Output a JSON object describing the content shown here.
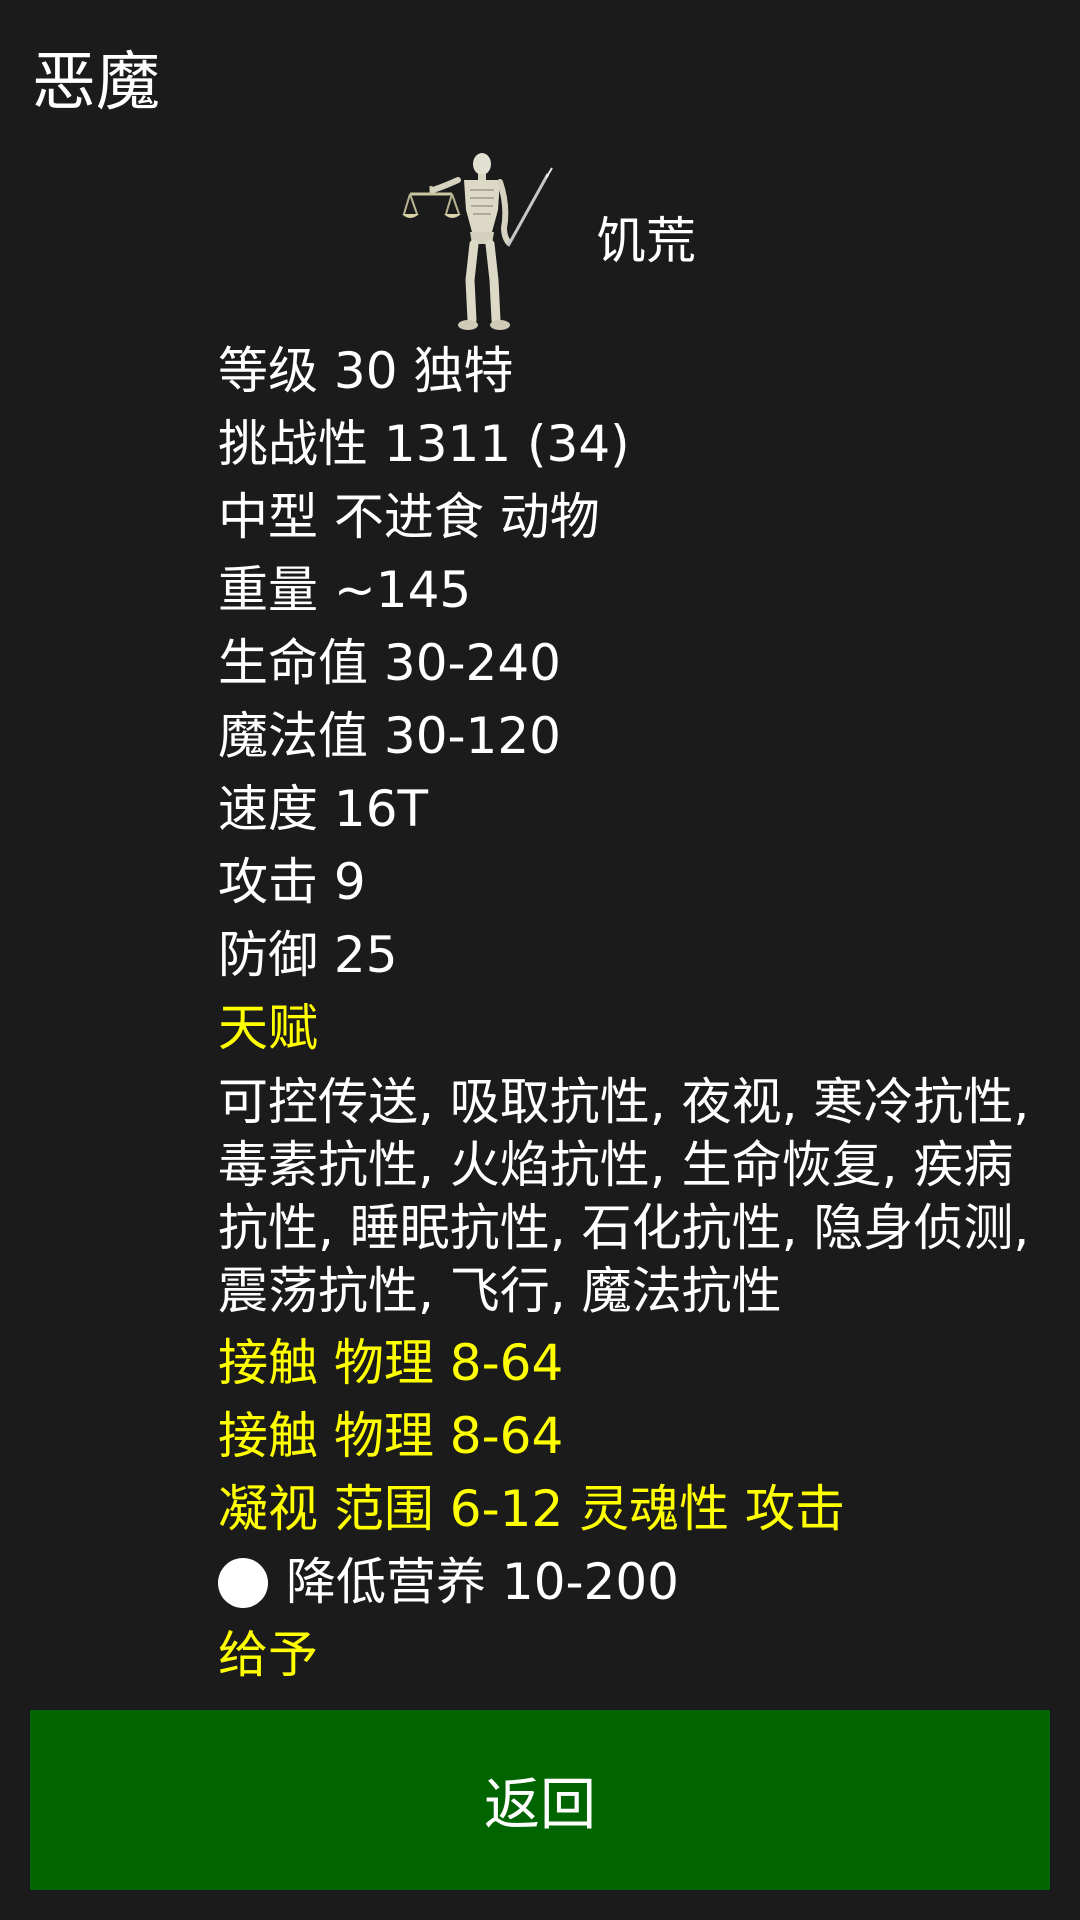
{
  "page": {
    "title": "恶魔"
  },
  "monster": {
    "name": "饥荒",
    "figure_icon": "skeleton-with-scales-and-scythe"
  },
  "stats": {
    "level": "等级 30 独特",
    "challenge": "挑战性 1311 (34)",
    "type": "中型 不进食 动物",
    "weight": "重量 ~145",
    "hp": "生命值 30-240",
    "mp": "魔法值 30-120",
    "speed": "速度 16T",
    "attack": "攻击 9",
    "defense": "防御 25"
  },
  "talents": {
    "heading": "天赋",
    "list": "可控传送, 吸取抗性, 夜视, 寒冷抗性, 毒素抗性, 火焰抗性, 生命恢复, 疾病抗性, 睡眠抗性, 石化抗性, 隐身侦测, 震荡抗性, 飞行, 魔法抗性"
  },
  "attacks": [
    "接触 物理 8-64",
    "接触 物理 8-64",
    "凝视 范围 6-12 灵魂性 攻击"
  ],
  "special": {
    "text": "降低营养 10-200",
    "icon": "white-circle-icon"
  },
  "gives": "给予",
  "actions": {
    "back_label": "返回"
  },
  "colors": {
    "background": "#1b1b1b",
    "highlight": "#ffff00",
    "button": "#006400"
  }
}
